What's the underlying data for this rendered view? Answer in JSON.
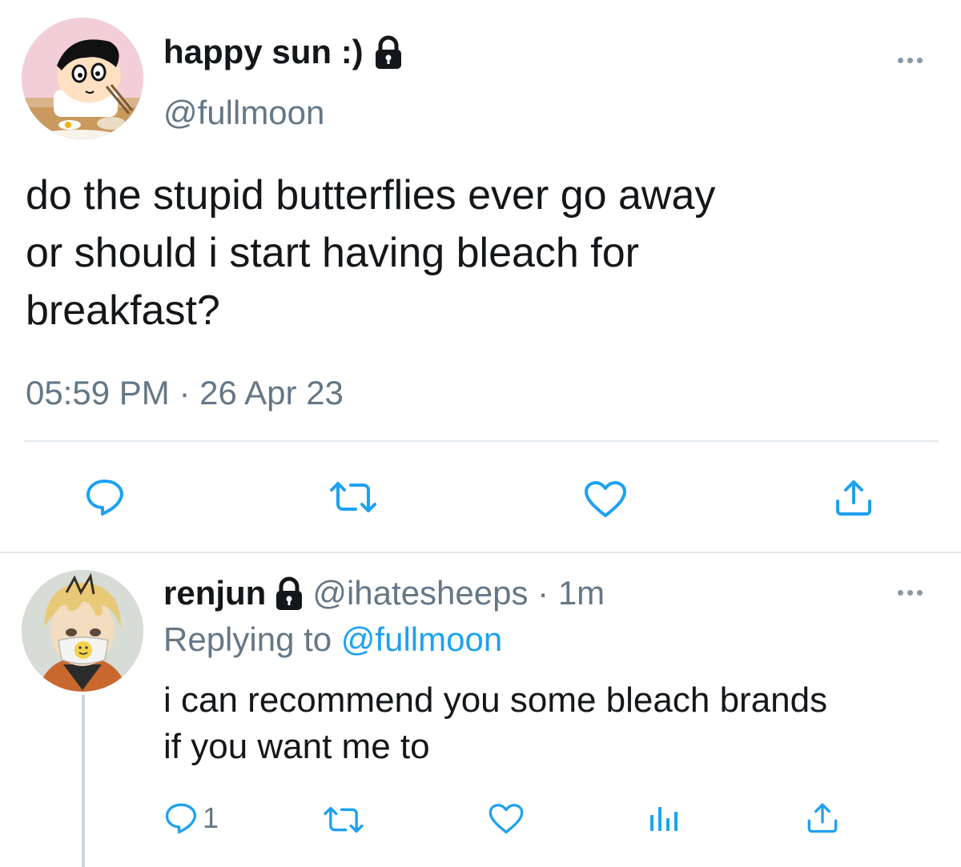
{
  "tweet": {
    "display_name": "happy sun :)",
    "handle": "@fullmoon",
    "text_line1": "do the stupid butterflies ever go away",
    "text_line2": "or should i start having bleach for",
    "text_line3": "breakfast?",
    "timestamp": "05:59 PM · 26 Apr 23",
    "avatar_icon": "cartoon-boy-avatar",
    "protected_icon": "lock-icon"
  },
  "reply": {
    "display_name": "renjun",
    "handle_time": "@ihatesheeps · 1m",
    "replying_prefix": "Replying to",
    "replying_handle": "@fullmoon",
    "text_line1": "i can recommend you some bleach brands",
    "text_line2": "if you want me to",
    "reply_count": "1",
    "avatar_icon": "anime-boy-mask-avatar",
    "protected_icon": "lock-icon"
  },
  "colors": {
    "link": "#1da1f2",
    "muted": "#657786",
    "icon": "#1da1f2",
    "reply_icon": "#657786"
  }
}
